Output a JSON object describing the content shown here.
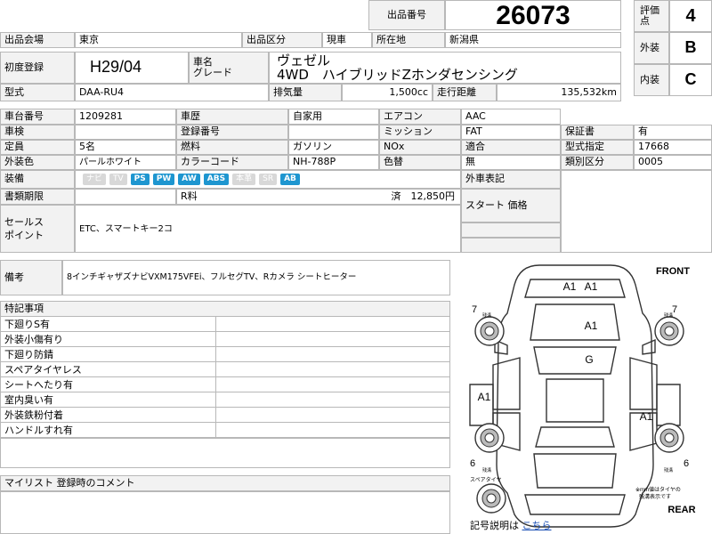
{
  "header": {
    "lot_label": "出品番号",
    "lot_number": "26073"
  },
  "grades": {
    "overall_label": "評価点",
    "overall": "4",
    "exterior_label": "外装",
    "exterior": "B",
    "interior_label": "内装",
    "interior": "C"
  },
  "row1": {
    "venue_label": "出品会場",
    "venue": "東京",
    "category_label": "出品区分",
    "category": "現車",
    "location_label": "所在地",
    "location": "新潟県"
  },
  "row2": {
    "reg_label": "初度登録",
    "reg": "H29/04",
    "name_label": "車名",
    "grade_label": "グレード",
    "car_name": "ヴェゼル",
    "grade": "4WD　ハイブリッドZホンダセンシング"
  },
  "row3": {
    "model_label": "型式",
    "model": "DAA-RU4",
    "displacement_label": "排気量",
    "displacement": "1,500cc",
    "mileage_label": "走行距離",
    "mileage": "135,532km"
  },
  "specs": {
    "chassis_label": "車台番号",
    "chassis": "1209281",
    "history_label": "車歴",
    "history": "自家用",
    "ac_label": "エアコン",
    "ac": "AAC",
    "inspection_label": "車検",
    "regno_label": "登録番号",
    "mission_label": "ミッション",
    "mission": "FAT",
    "warranty_label": "保証書",
    "warranty": "有",
    "capacity_label": "定員",
    "capacity": "5名",
    "fuel_label": "燃料",
    "fuel": "ガソリン",
    "nox_label": "NOx",
    "compliance_label": "適合",
    "typedesig_label": "型式指定",
    "typedesig": "17668",
    "color_label": "外装色",
    "color": "パールホワイト",
    "colorcode_label": "カラーコード",
    "colorcode": "NH-788P",
    "repaint_label": "色替",
    "repaint": "無",
    "classcat_label": "類別区分",
    "classcat": "0005",
    "equipment_label": "装備",
    "tags": [
      {
        "text": "ナビ",
        "on": false
      },
      {
        "text": "TV",
        "on": false
      },
      {
        "text": "PS",
        "on": true
      },
      {
        "text": "PW",
        "on": true
      },
      {
        "text": "AW",
        "on": true
      },
      {
        "text": "ABS",
        "on": true
      },
      {
        "text": "本革",
        "on": false
      },
      {
        "text": "SR",
        "on": false
      },
      {
        "text": "AB",
        "on": true
      }
    ],
    "outside_record_label": "外車表記",
    "docs_label": "書類期限",
    "rfee_label": "R料",
    "rfee_status": "済",
    "rfee": "12,850円",
    "start_price_label": "スタート 価格",
    "sales_label_1": "セールス",
    "sales_label_2": "ポイント",
    "sales_points": "ETC、スマートキー2コ"
  },
  "remarks": {
    "label": "備考",
    "text": "8インチギャザズナビVXM175VFEi、フルセグTV、Rカメラ シートヒーター"
  },
  "notes": {
    "header": "特記事項",
    "items": [
      "下廻りS有",
      "外装小傷有り",
      "下廻り防錆",
      "スペアタイヤレス",
      "シートへたり有",
      "室内臭い有",
      "外装鉄粉付着",
      "ハンドルすれ有"
    ]
  },
  "mylist": {
    "label": "マイリスト 登録時のコメント"
  },
  "diagram": {
    "front": "FRONT",
    "rear": "REAR",
    "marks": {
      "hood_left": "A1",
      "hood_right": "A1",
      "windshield": "A1",
      "roof": "G",
      "left_side": "A1",
      "right_side": "A1",
      "tire_fl": "7",
      "tire_fr": "7",
      "tire_rl": "6",
      "tire_rr": "6"
    },
    "tire_small_label": "残溝",
    "spare_label": "スペアタイヤ",
    "note_line1": "※mm値はタイヤの",
    "note_line2": "残溝表示です",
    "legend_label": "記号説明は",
    "legend_link": "こちら"
  },
  "colors": {
    "tag_on": "#1e96d0",
    "tag_off": "#d8d8d8",
    "label_bg": "#f2f2f2",
    "border": "#b8b8b8",
    "link": "#1a4fb5"
  }
}
